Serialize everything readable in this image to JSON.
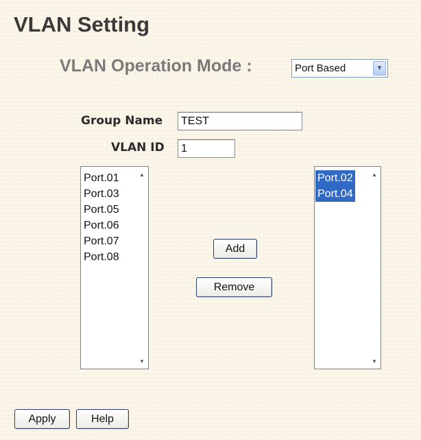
{
  "page": {
    "title": "VLAN Setting"
  },
  "mode": {
    "label": "VLAN Operation Mode :",
    "selected": "Port Based"
  },
  "form": {
    "group_name_label": "Group Name",
    "group_name_value": "TEST",
    "vlan_id_label": "VLAN ID",
    "vlan_id_value": "1"
  },
  "available_ports": [
    "Port.01",
    "Port.03",
    "Port.05",
    "Port.06",
    "Port.07",
    "Port.08"
  ],
  "member_ports": [
    "Port.02",
    "Port.04"
  ],
  "buttons": {
    "add": "Add",
    "remove": "Remove",
    "apply": "Apply",
    "help": "Help"
  },
  "icons": {
    "dropdown": "chevron-down-icon",
    "scroll_up": "scroll-up-arrow-icon",
    "scroll_down": "scroll-down-arrow-icon"
  },
  "colors": {
    "background": "#fbf6ea",
    "selection": "#316ac5"
  }
}
